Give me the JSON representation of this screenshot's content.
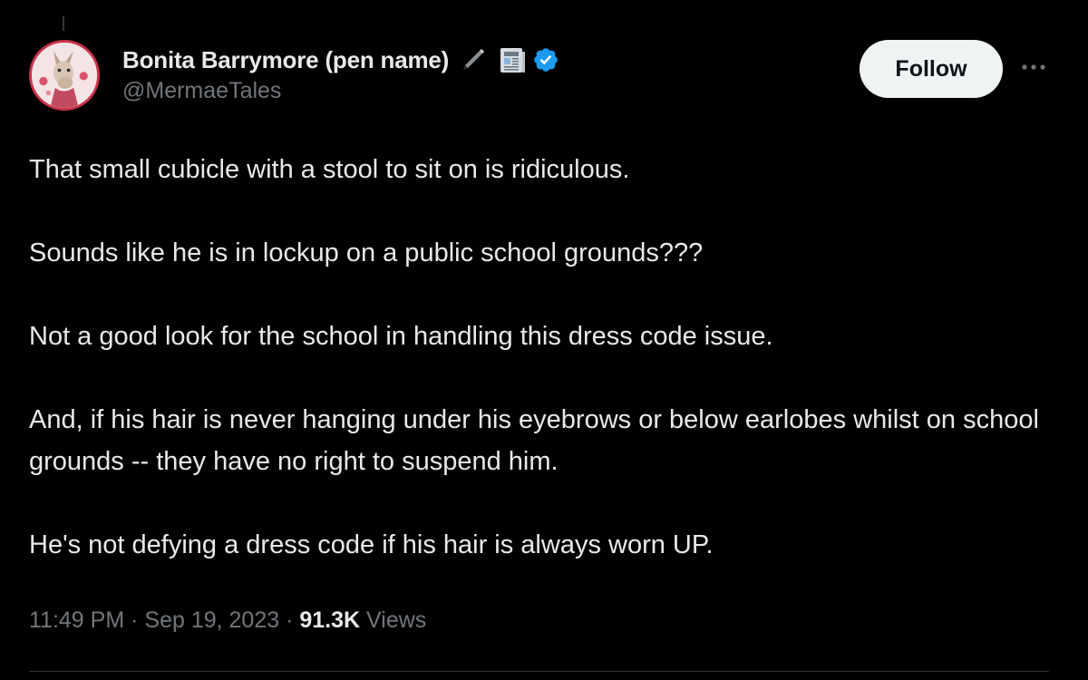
{
  "author": {
    "display_name": "Bonita Barrymore (pen name)",
    "handle": "@MermaeTales",
    "name_emojis": [
      "pen-icon",
      "newspaper-icon"
    ],
    "verified_icon": "verified-badge-icon",
    "avatar_icon": "llama-avatar"
  },
  "actions": {
    "follow_label": "Follow",
    "more_icon": "more-dots-icon"
  },
  "tweet": {
    "paragraphs": [
      "That small cubicle with a stool to sit on is ridiculous.",
      "Sounds like he is in lockup on a public school grounds???",
      "Not a good look for the school in handling this dress code issue.",
      "And, if his hair is never hanging under his eyebrows or below earlobes whilst on school grounds -- they have no right to suspend him.",
      "He's not defying a dress code if his hair is always worn UP."
    ]
  },
  "meta": {
    "time": "11:49 PM",
    "date": "Sep 19, 2023",
    "separator": "·",
    "views_count": "91.3K",
    "views_label": "Views"
  },
  "colors": {
    "background": "#000000",
    "text_primary": "#e7e9ea",
    "text_secondary": "#71767b",
    "verified_blue": "#1d9bf0",
    "follow_bg": "#eff3f4"
  }
}
